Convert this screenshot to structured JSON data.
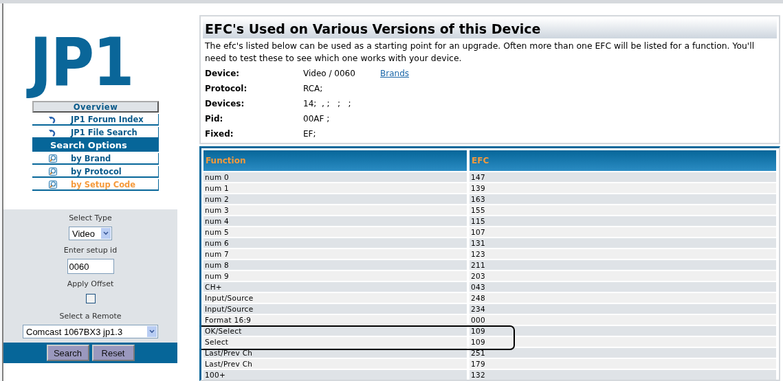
{
  "logo": {
    "text": "JP1"
  },
  "menu": [
    {
      "kind": "button",
      "label": "Overview",
      "selected": false
    },
    {
      "kind": "link",
      "label": "JP1 Forum Index",
      "selected": false
    },
    {
      "kind": "link",
      "label": "JP1 File Search",
      "selected": false
    },
    {
      "kind": "section",
      "label": "Search Options",
      "selected": false
    },
    {
      "kind": "search",
      "label": "by Brand",
      "selected": false
    },
    {
      "kind": "search",
      "label": "by Protocol",
      "selected": false
    },
    {
      "kind": "search",
      "label": "by Setup Code",
      "selected": true
    }
  ],
  "form": {
    "type_label": "Select Type",
    "type_value": "Video",
    "setup_label": "Enter setup id",
    "setup_value": "0060",
    "offset_label": "Apply Offset",
    "offset_checked": false,
    "remote_label": "Select a Remote",
    "remote_value": "Comcast 1067BX3 jp1.3",
    "buttons": [
      "Search",
      "Reset"
    ]
  },
  "info": {
    "title": "EFC's Used on Various Versions of this Device",
    "intro": "The efc's listed below can be used as a starting point for an upgrade. Often more than one EFC will be listed for a function. You'll need to test these to see which one works with your device.",
    "fields": [
      {
        "label": "Device:",
        "value": "Video / 0060",
        "link": "Brands"
      },
      {
        "label": "Protocol:",
        "value": "RCA;"
      },
      {
        "label": "Devices:",
        "value": "14;  , ;   ;   ;"
      },
      {
        "label": "Pid:",
        "value": "00AF ;"
      },
      {
        "label": "Fixed:",
        "value": "EF;"
      }
    ]
  },
  "table": {
    "columns": [
      "Function",
      "EFC"
    ],
    "rows": [
      {
        "function": "num 0",
        "efc": "147",
        "circled": false
      },
      {
        "function": "num 1",
        "efc": "139",
        "circled": false
      },
      {
        "function": "num 2",
        "efc": "163",
        "circled": false
      },
      {
        "function": "num 3",
        "efc": "155",
        "circled": false
      },
      {
        "function": "num 4",
        "efc": "115",
        "circled": false
      },
      {
        "function": "num 5",
        "efc": "107",
        "circled": false
      },
      {
        "function": "num 6",
        "efc": "131",
        "circled": false
      },
      {
        "function": "num 7",
        "efc": "123",
        "circled": false
      },
      {
        "function": "num 8",
        "efc": "211",
        "circled": false
      },
      {
        "function": "num 9",
        "efc": "203",
        "circled": false
      },
      {
        "function": "CH+",
        "efc": "043",
        "circled": false
      },
      {
        "function": "Input/Source",
        "efc": "248",
        "circled": false
      },
      {
        "function": "Input/Source",
        "efc": "234",
        "circled": false
      },
      {
        "function": "Format 16:9",
        "efc": "000",
        "circled": false
      },
      {
        "function": "OK/Select",
        "efc": "109",
        "circled": true
      },
      {
        "function": "Select",
        "efc": "109",
        "circled": true
      },
      {
        "function": "Last/Prev Ch",
        "efc": "251",
        "circled": false
      },
      {
        "function": "Last/Prev Ch",
        "efc": "179",
        "circled": false
      },
      {
        "function": "100+",
        "efc": "132",
        "circled": false
      }
    ]
  }
}
